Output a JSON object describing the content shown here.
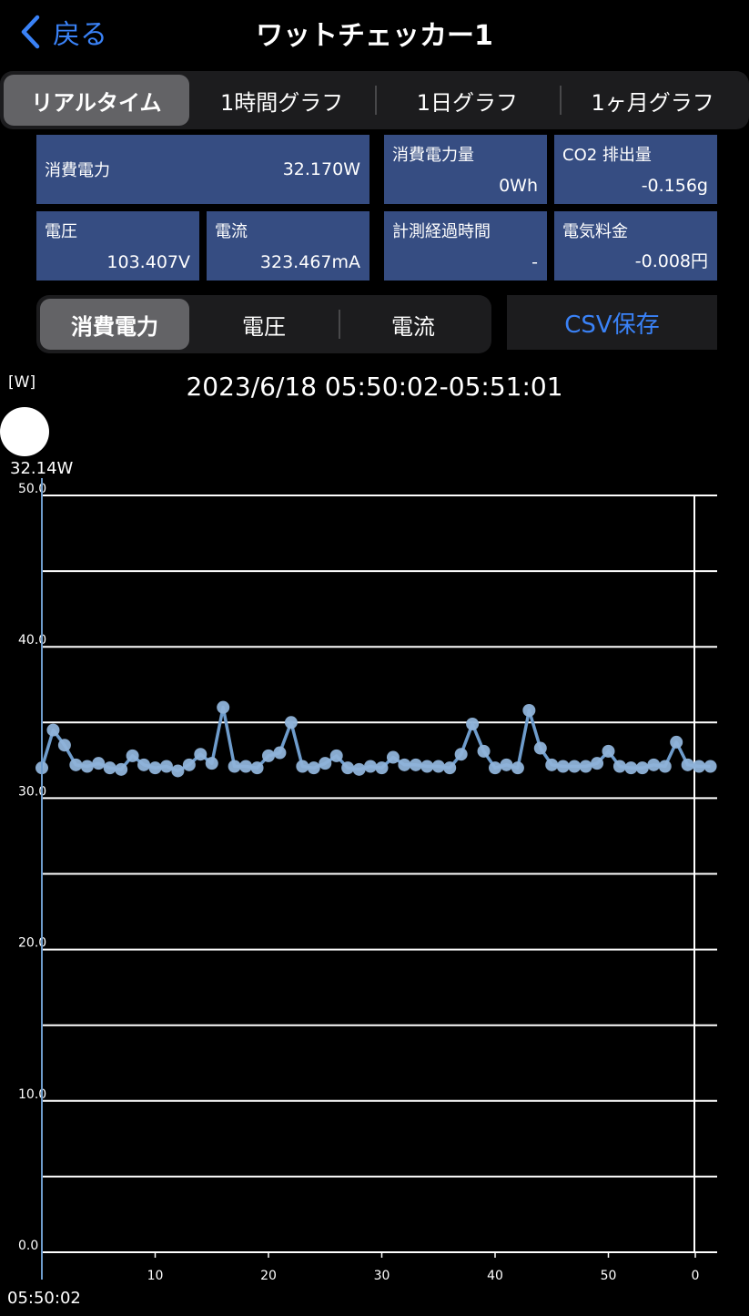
{
  "nav": {
    "back_label": "戻る",
    "title": "ワットチェッカー1"
  },
  "period_tabs": [
    "リアルタイム",
    "1時間グラフ",
    "1日グラフ",
    "1ヶ月グラフ"
  ],
  "period_selected": 0,
  "cards": {
    "power": {
      "label": "消費電力",
      "value": "32.170W"
    },
    "energy": {
      "label": "消費電力量",
      "value": "0Wh"
    },
    "co2": {
      "label": "CO2 排出量",
      "value": "-0.156g"
    },
    "voltage": {
      "label": "電圧",
      "value": "103.407V"
    },
    "current": {
      "label": "電流",
      "value": "323.467mA"
    },
    "elapsed": {
      "label": "計測経過時間",
      "value": "-"
    },
    "cost": {
      "label": "電気料金",
      "value": "-0.008円"
    }
  },
  "metric_tabs": [
    "消費電力",
    "電圧",
    "電流"
  ],
  "metric_selected": 0,
  "csv_button": "CSV保存",
  "chart_header": {
    "unit": "[W]",
    "range": "2023/6/18 05:50:02-05:51:01"
  },
  "cursor": {
    "readout": "32.14W",
    "start_time": "05:50:02"
  },
  "colors": {
    "accent": "#3a82f7",
    "card_bg": "#364d82",
    "line": "#6e9ccc",
    "marker": "#8fb3d9"
  },
  "chart_data": {
    "type": "line",
    "title": "",
    "xlabel": "",
    "ylabel": "[W]",
    "ylim": [
      0,
      50
    ],
    "y_ticks": [
      "0.0",
      "10.0",
      "20.0",
      "30.0",
      "40.0",
      "50.0"
    ],
    "x_ticks": [
      {
        "x": 10,
        "label": "10"
      },
      {
        "x": 20,
        "label": "20"
      },
      {
        "x": 30,
        "label": "30"
      },
      {
        "x": 40,
        "label": "40"
      },
      {
        "x": 50,
        "label": "50"
      },
      {
        "x": 60,
        "label": "0"
      }
    ],
    "xlim": [
      0,
      61
    ],
    "grid": true,
    "series": [
      {
        "x": [
          0,
          1,
          2,
          3,
          4,
          5,
          6,
          7,
          8,
          9,
          10,
          11,
          12,
          13,
          14,
          15,
          16,
          17,
          18,
          19,
          20,
          21,
          22,
          23,
          24,
          25,
          26,
          27,
          28,
          29,
          30,
          31,
          32,
          33,
          34,
          35,
          36,
          37,
          38,
          39,
          40,
          41,
          42,
          43,
          44,
          45,
          46,
          47,
          48,
          49,
          50,
          51,
          52,
          53,
          54,
          55,
          56,
          57,
          58,
          59
        ],
        "values": [
          32.0,
          34.5,
          33.5,
          32.2,
          32.1,
          32.3,
          32.0,
          31.9,
          32.8,
          32.2,
          32.0,
          32.1,
          31.8,
          32.2,
          32.9,
          32.3,
          36.0,
          32.1,
          32.1,
          32.0,
          32.8,
          33.0,
          35.0,
          32.1,
          32.0,
          32.3,
          32.8,
          32.0,
          31.9,
          32.1,
          32.0,
          32.7,
          32.2,
          32.2,
          32.1,
          32.1,
          32.0,
          32.9,
          34.9,
          33.1,
          32.0,
          32.2,
          32.0,
          35.8,
          33.3,
          32.2,
          32.1,
          32.1,
          32.1,
          32.3,
          33.1,
          32.1,
          32.0,
          32.0,
          32.2,
          32.1,
          33.7,
          32.2,
          32.1,
          32.1
        ]
      }
    ]
  }
}
